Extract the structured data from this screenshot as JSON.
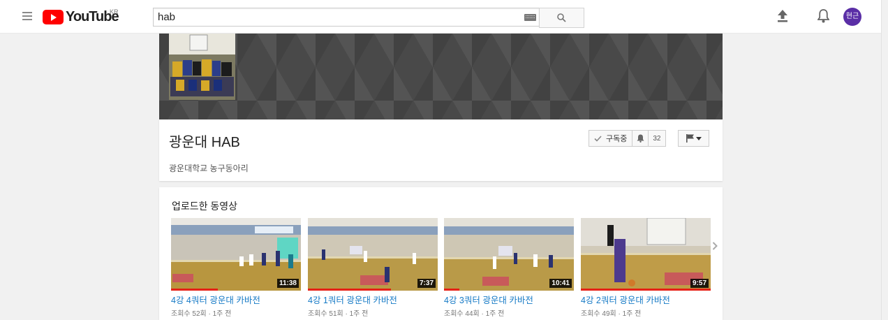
{
  "header": {
    "logo_text": "YouTube",
    "country": "KR",
    "search_value": "hab",
    "avatar_text": "현근"
  },
  "channel": {
    "title": "광운대 HAB",
    "description": "광운대학교 농구동아리",
    "subscribed_label": "구독중",
    "subscriber_count": "32"
  },
  "uploads": {
    "title": "업로드한 동영상",
    "videos": [
      {
        "title": "4강 4쿼터 광운대 카바전",
        "views": "조회수 52회",
        "age": "1주 전",
        "duration": "11:38",
        "watched": 0.36
      },
      {
        "title": "4강 1쿼터 광운대 카바전",
        "views": "조회수 51회",
        "age": "1주 전",
        "duration": "7:37",
        "watched": 0.64
      },
      {
        "title": "4강 3쿼터 광운대 카바전",
        "views": "조회수 44회",
        "age": "1주 전",
        "duration": "10:41",
        "watched": 0.12
      },
      {
        "title": "4강 2쿼터 광운대 카바전",
        "views": "조회수 49회",
        "age": "1주 전",
        "duration": "9:57",
        "watched": 1.0
      }
    ]
  },
  "colors": {
    "brand_red": "#ff0000",
    "link_blue": "#167ac6",
    "avatar_purple": "#5a2ea6",
    "progress_red": "#e62117"
  },
  "icons": [
    "menu-icon",
    "search-icon",
    "keyboard-icon",
    "upload-icon",
    "bell-icon",
    "check-icon",
    "flag-icon",
    "chevron-right-icon"
  ]
}
